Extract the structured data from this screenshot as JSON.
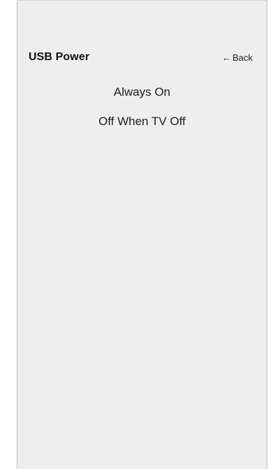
{
  "header": {
    "title": "USB Power",
    "back_icon": "←",
    "back_label": "Back"
  },
  "options": [
    {
      "label": "Always On"
    },
    {
      "label": "Off When TV Off"
    }
  ]
}
